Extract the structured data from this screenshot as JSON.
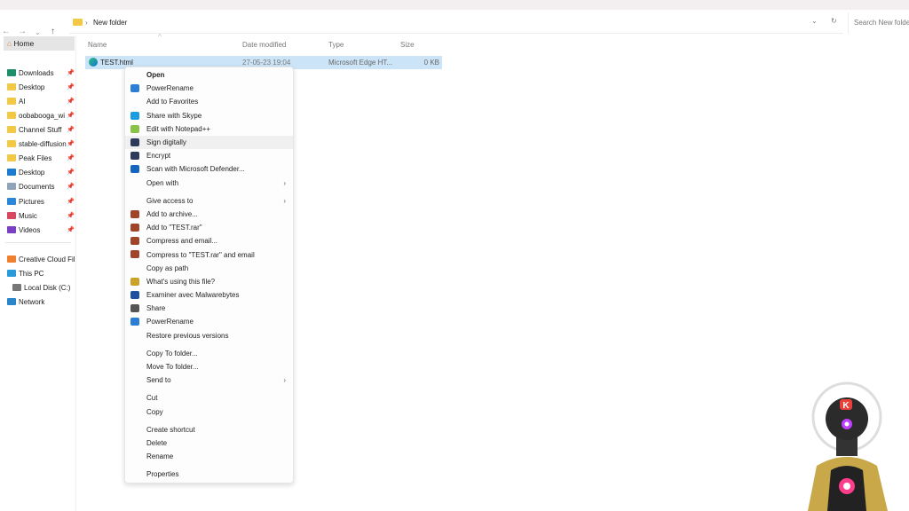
{
  "address": {
    "path": "New folder",
    "search_placeholder": "Search New folder"
  },
  "sidebar": {
    "home": "Home",
    "items": [
      {
        "label": "Downloads",
        "color": "#1f8f6a",
        "pin": true
      },
      {
        "label": "Desktop",
        "color": "#f3c845",
        "pin": true
      },
      {
        "label": "AI",
        "color": "#f3c845",
        "pin": true
      },
      {
        "label": "oobabooga_wi",
        "color": "#f3c845",
        "pin": true
      },
      {
        "label": "Channel Stuff",
        "color": "#f3c845",
        "pin": true
      },
      {
        "label": "stable-diffusion",
        "color": "#f3c845",
        "pin": true
      },
      {
        "label": "Peak Files",
        "color": "#f3c845",
        "pin": true
      },
      {
        "label": "Desktop",
        "color": "#1a7bd0",
        "pin": true
      },
      {
        "label": "Documents",
        "color": "#8fa4b8",
        "pin": true
      },
      {
        "label": "Pictures",
        "color": "#2b86d9",
        "pin": true
      },
      {
        "label": "Music",
        "color": "#d9475e",
        "pin": true
      },
      {
        "label": "Videos",
        "color": "#7b3fc4",
        "pin": true
      }
    ],
    "lower": [
      {
        "label": "Creative Cloud Files",
        "color": "#f08030"
      },
      {
        "label": "This PC",
        "color": "#2a9bd8"
      },
      {
        "label": "Local Disk (C:)",
        "color": "#777"
      },
      {
        "label": "Network",
        "color": "#2a86c8"
      }
    ]
  },
  "columns": {
    "name": "Name",
    "date": "Date modified",
    "type": "Type",
    "size": "Size"
  },
  "file": {
    "name": "TEST.html",
    "date": "27-05-23 19:04",
    "type": "Microsoft Edge HT...",
    "size": "0 KB"
  },
  "menu": [
    {
      "label": "Open",
      "bold": true
    },
    {
      "label": "PowerRename",
      "icon": "#2a7fd4"
    },
    {
      "label": "Add to Favorites"
    },
    {
      "label": "Share with Skype",
      "icon": "#1a9ee0"
    },
    {
      "label": "Edit with Notepad++",
      "icon": "#8bc34a"
    },
    {
      "label": "Sign digitally",
      "icon": "#2d3a5c",
      "hover": true
    },
    {
      "label": "Encrypt",
      "icon": "#2d3a5c"
    },
    {
      "label": "Scan with Microsoft Defender...",
      "icon": "#1565c0"
    },
    {
      "label": "Open with",
      "sub": true
    },
    {
      "sep": true
    },
    {
      "label": "Give access to",
      "sub": true
    },
    {
      "label": "Add to archive...",
      "icon": "#a0452a"
    },
    {
      "label": "Add to \"TEST.rar\"",
      "icon": "#a0452a"
    },
    {
      "label": "Compress and email...",
      "icon": "#a0452a"
    },
    {
      "label": "Compress to \"TEST.rar\" and email",
      "icon": "#a0452a"
    },
    {
      "label": "Copy as path"
    },
    {
      "label": "What's using this file?",
      "icon": "#c9a227"
    },
    {
      "label": "Examiner avec Malwarebytes",
      "icon": "#1e4fa0"
    },
    {
      "label": "Share",
      "icon": "#555"
    },
    {
      "label": "PowerRename",
      "icon": "#2a7fd4"
    },
    {
      "label": "Restore previous versions"
    },
    {
      "sep": true
    },
    {
      "label": "Copy To folder..."
    },
    {
      "label": "Move To folder..."
    },
    {
      "label": "Send to",
      "sub": true
    },
    {
      "sep": true
    },
    {
      "label": "Cut"
    },
    {
      "label": "Copy"
    },
    {
      "sep": true
    },
    {
      "label": "Create shortcut"
    },
    {
      "label": "Delete"
    },
    {
      "label": "Rename"
    },
    {
      "sep": true
    },
    {
      "label": "Properties"
    }
  ],
  "avatar": {
    "letter": "K"
  }
}
